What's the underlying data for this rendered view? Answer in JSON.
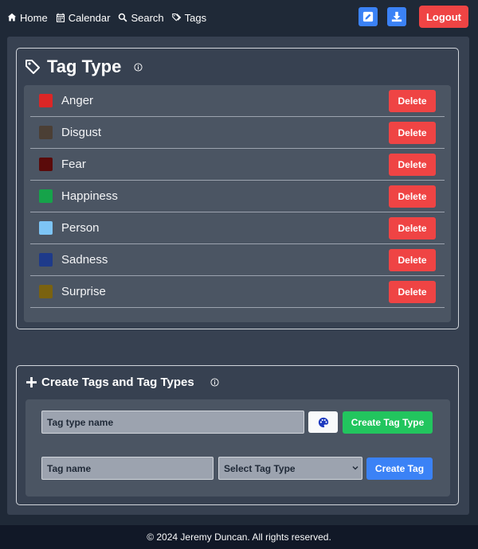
{
  "nav": {
    "links": [
      {
        "label": "Home",
        "icon": "home-icon"
      },
      {
        "label": "Calendar",
        "icon": "calendar-icon"
      },
      {
        "label": "Search",
        "icon": "search-icon"
      },
      {
        "label": "Tags",
        "icon": "tags-icon"
      }
    ],
    "edit_icon": "edit-icon",
    "download_icon": "download-icon",
    "logout_label": "Logout"
  },
  "tag_type_section": {
    "title": "Tag Type",
    "tags": [
      {
        "name": "Anger",
        "color": "#dc2626",
        "delete_label": "Delete"
      },
      {
        "name": "Disgust",
        "color": "#4b3f35",
        "delete_label": "Delete"
      },
      {
        "name": "Fear",
        "color": "#5a0a0a",
        "delete_label": "Delete"
      },
      {
        "name": "Happiness",
        "color": "#16a34a",
        "delete_label": "Delete"
      },
      {
        "name": "Person",
        "color": "#7dc4f5",
        "delete_label": "Delete"
      },
      {
        "name": "Sadness",
        "color": "#1e3a8a",
        "delete_label": "Delete"
      },
      {
        "name": "Surprise",
        "color": "#7a6210",
        "delete_label": "Delete"
      }
    ]
  },
  "create_section": {
    "title": "Create Tags and Tag Types",
    "tag_type_name_placeholder": "Tag type name",
    "create_tag_type_label": "Create Tag Type",
    "tag_name_placeholder": "Tag name",
    "select_tag_type_label": "Select Tag Type",
    "create_tag_label": "Create Tag"
  },
  "footer": {
    "text": "© 2024 Jeremy Duncan. All rights reserved."
  },
  "colors": {
    "background": "#1f2937",
    "panel": "#374151",
    "inner_panel": "#4b5563",
    "danger": "#ef4444",
    "success": "#22c55e",
    "primary": "#3b82f6"
  }
}
